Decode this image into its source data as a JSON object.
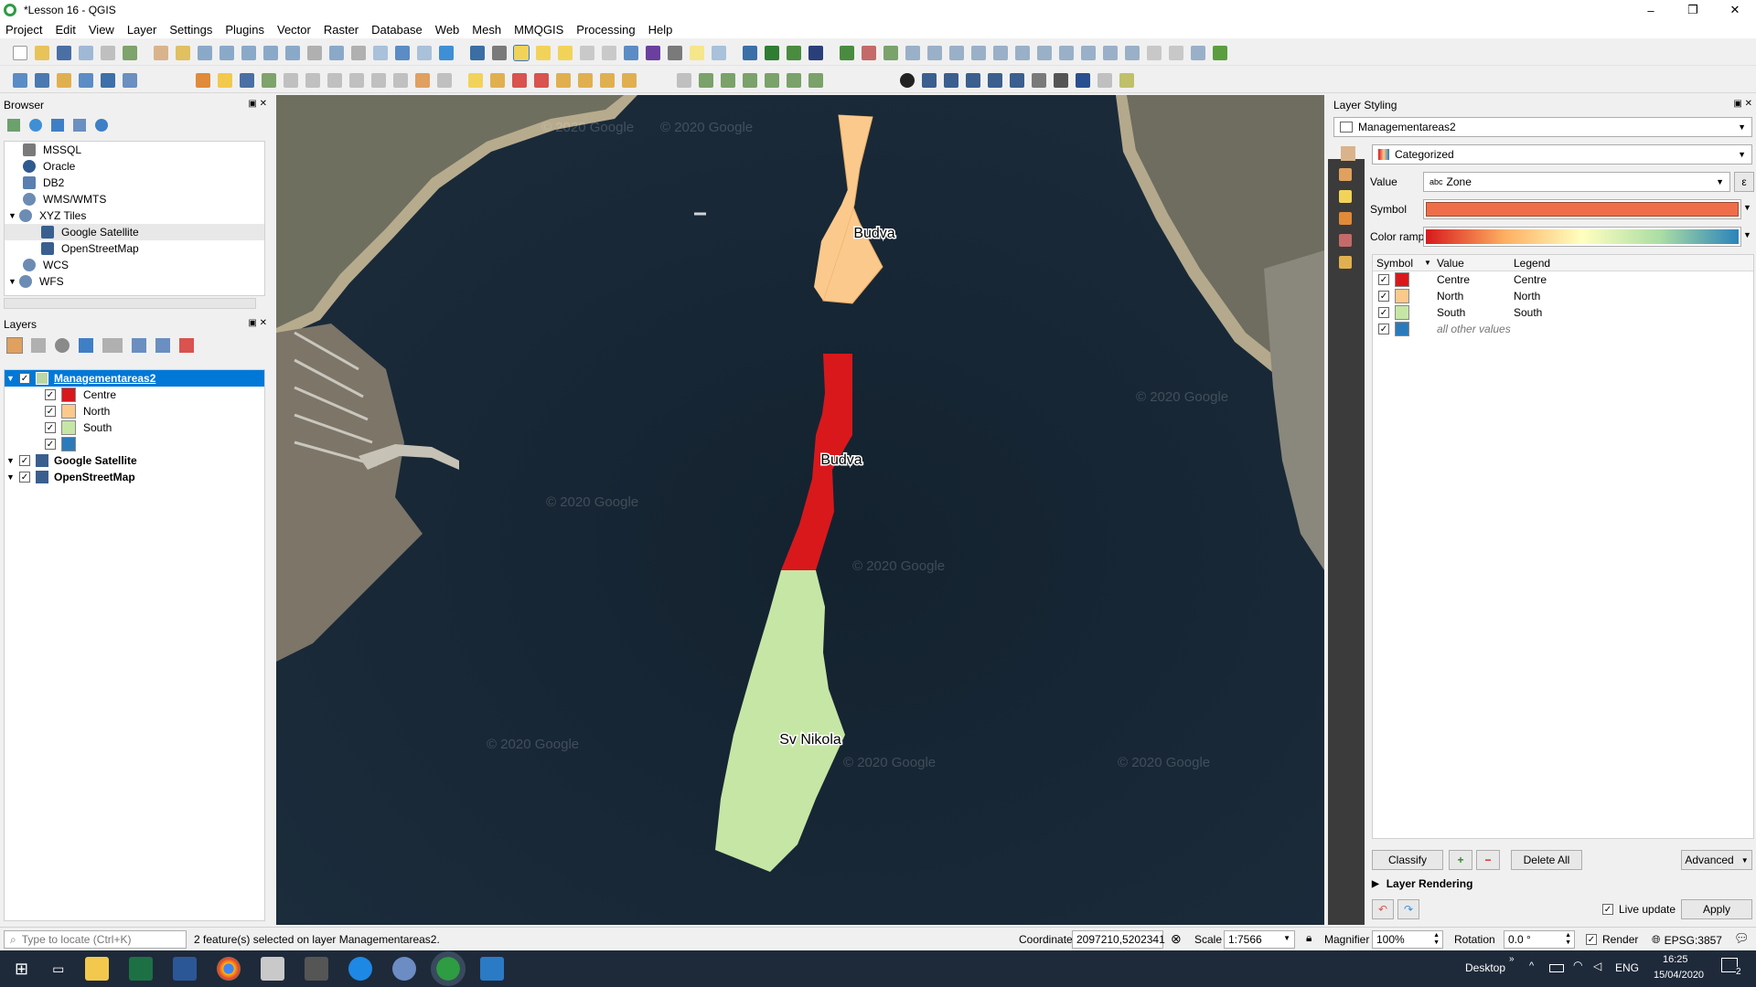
{
  "window": {
    "title": "*Lesson 16 - QGIS",
    "min": "–",
    "max": "❐",
    "close": "✕"
  },
  "menu": [
    "Project",
    "Edit",
    "View",
    "Layer",
    "Settings",
    "Plugins",
    "Vector",
    "Raster",
    "Database",
    "Web",
    "Mesh",
    "MMQGIS",
    "Processing",
    "Help"
  ],
  "browser": {
    "title": "Browser",
    "items": [
      {
        "label": "MSSQL",
        "icon": "mssql-icon",
        "color": "#7a7a7a"
      },
      {
        "label": "Oracle",
        "icon": "oracle-icon",
        "color": "#2f5a8f"
      },
      {
        "label": "DB2",
        "icon": "db2-icon",
        "color": "#5b7fb0"
      },
      {
        "label": "WMS/WMTS",
        "icon": "globe-icon",
        "color": "#6c8cb4"
      },
      {
        "label": "XYZ Tiles",
        "icon": "globe-icon",
        "color": "#6c8cb4"
      },
      {
        "label": "Google Satellite",
        "icon": "tiles-icon",
        "color": "#3a5f8f"
      },
      {
        "label": "OpenStreetMap",
        "icon": "tiles-icon",
        "color": "#3a5f8f"
      },
      {
        "label": "WCS",
        "icon": "globe-icon",
        "color": "#6c8cb4"
      },
      {
        "label": "WFS",
        "icon": "globe-icon",
        "color": "#6c8cb4"
      }
    ]
  },
  "layers": {
    "title": "Layers",
    "main": "Managementareas2",
    "classes": [
      {
        "label": "Centre",
        "color": "#d9181c"
      },
      {
        "label": "North",
        "color": "#fbc98b"
      },
      {
        "label": "South",
        "color": "#c6e6a6"
      },
      {
        "label": "",
        "color": "#2b7bba"
      }
    ],
    "others": [
      "Google Satellite",
      "OpenStreetMap"
    ]
  },
  "map": {
    "labels": [
      "Budva",
      "Budva",
      "Sv Nikola"
    ],
    "watermark": "© 2020 Google"
  },
  "styling": {
    "title": "Layer Styling",
    "layer": "Managementareas2",
    "renderer": "Categorized",
    "value_label": "Value",
    "value_prefix": "abc",
    "value": "Zone",
    "symbol_label": "Symbol",
    "symbol_color": "#ef6e4a",
    "ramp_label": "Color ramp",
    "headers": [
      "Symbol",
      "Value",
      "Legend"
    ],
    "rows": [
      {
        "value": "Centre",
        "legend": "Centre",
        "color": "#d9181c"
      },
      {
        "value": "North",
        "legend": "North",
        "color": "#fbc98b"
      },
      {
        "value": "South",
        "legend": "South",
        "color": "#c6e6a6"
      },
      {
        "value": "",
        "legend": "all other values",
        "color": "#2b7bba"
      }
    ],
    "classify": "Classify",
    "delete_all": "Delete All",
    "advanced": "Advanced",
    "layer_rendering": "Layer Rendering",
    "live_update": "Live update",
    "apply": "Apply"
  },
  "status": {
    "locate_placeholder": "Type to locate (Ctrl+K)",
    "message": "2 feature(s) selected on layer Managementareas2.",
    "coord_label": "Coordinate",
    "coord": "2097210,5202341",
    "scale_label": "Scale",
    "scale": "1:7566",
    "magnifier_label": "Magnifier",
    "magnifier": "100%",
    "rotation_label": "Rotation",
    "rotation": "0.0 °",
    "render_label": "Render",
    "crs": "EPSG:3857"
  },
  "taskbar": {
    "desktop": "Desktop",
    "lang": "ENG",
    "time": "16:25",
    "date": "15/04/2020",
    "notif": "2"
  }
}
